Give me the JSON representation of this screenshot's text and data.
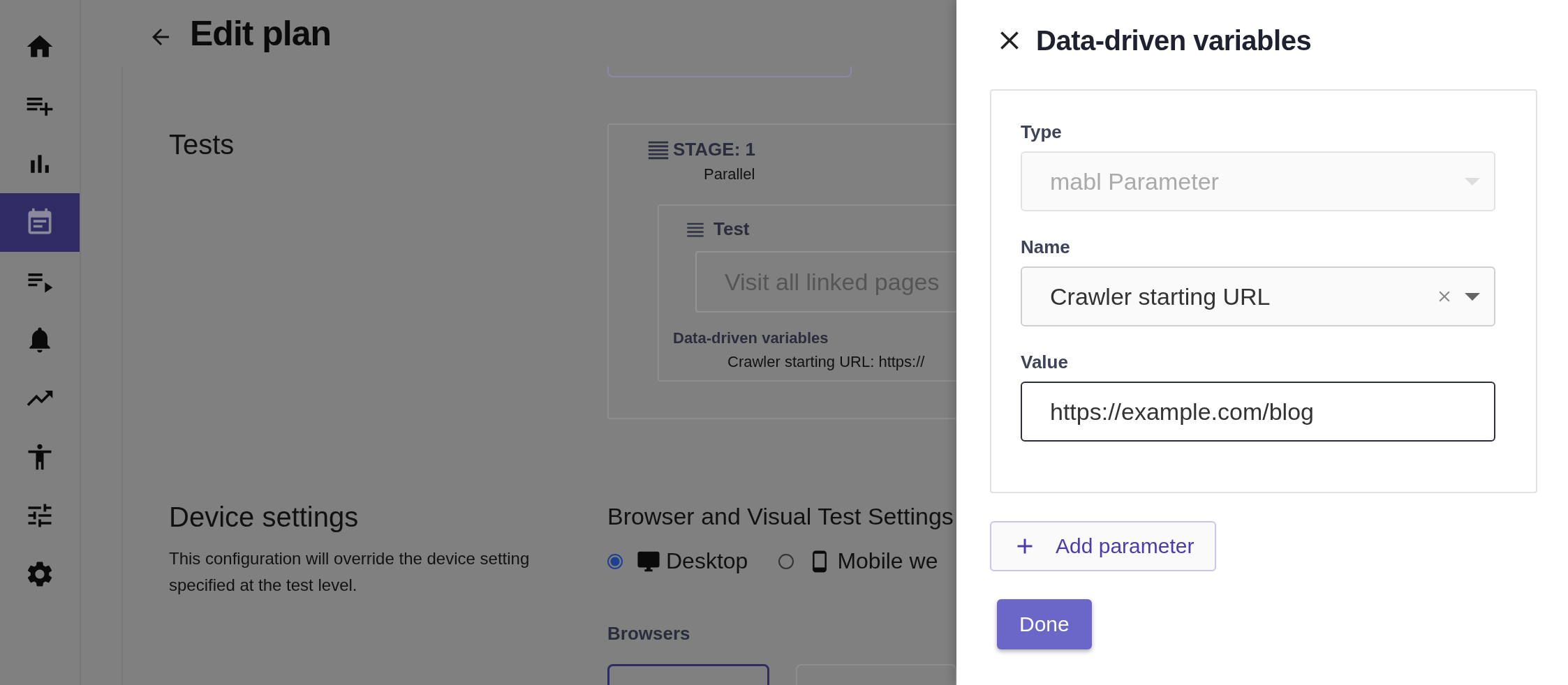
{
  "sidebar": {
    "items": [
      {
        "kind": "home",
        "selected": false
      },
      {
        "kind": "playlist-add",
        "selected": false
      },
      {
        "kind": "chart",
        "selected": false
      },
      {
        "kind": "calendar",
        "selected": true
      },
      {
        "kind": "playlist-play",
        "selected": false
      },
      {
        "kind": "bell",
        "selected": false
      },
      {
        "kind": "trend",
        "selected": false
      },
      {
        "kind": "person",
        "selected": false
      },
      {
        "kind": "sliders",
        "selected": false
      },
      {
        "kind": "gear",
        "selected": false
      }
    ]
  },
  "header": {
    "title": "Edit plan"
  },
  "tests": {
    "heading": "Tests",
    "stage": {
      "label": "STAGE: 1",
      "mode": "Parallel",
      "test": {
        "label": "Test",
        "name": "Visit all linked pages",
        "variables_heading": "Data-driven variables",
        "variables": [
          "Crawler starting URL: https://"
        ]
      }
    }
  },
  "device": {
    "heading": "Device settings",
    "description": "This configuration will override the device setting specified at the test level.",
    "browser_heading": "Browser and Visual Test Settings",
    "options": [
      {
        "kind": "desktop",
        "label": "Desktop",
        "selected": true
      },
      {
        "kind": "mobile",
        "label": "Mobile we",
        "selected": false
      }
    ],
    "browsers_label": "Browsers"
  },
  "drawer": {
    "title": "Data-driven variables",
    "fields": [
      {
        "kind": "select",
        "label": "Type",
        "value": "mabl Parameter",
        "disabled": true,
        "clearable": false,
        "focused": false
      },
      {
        "kind": "select",
        "label": "Name",
        "value": "Crawler starting URL",
        "disabled": false,
        "clearable": true,
        "focused": false
      },
      {
        "kind": "text",
        "label": "Value",
        "value": "https://example.com/blog",
        "disabled": false,
        "clearable": false,
        "focused": true
      }
    ],
    "add_button": "Add parameter",
    "done_button": "Done"
  }
}
